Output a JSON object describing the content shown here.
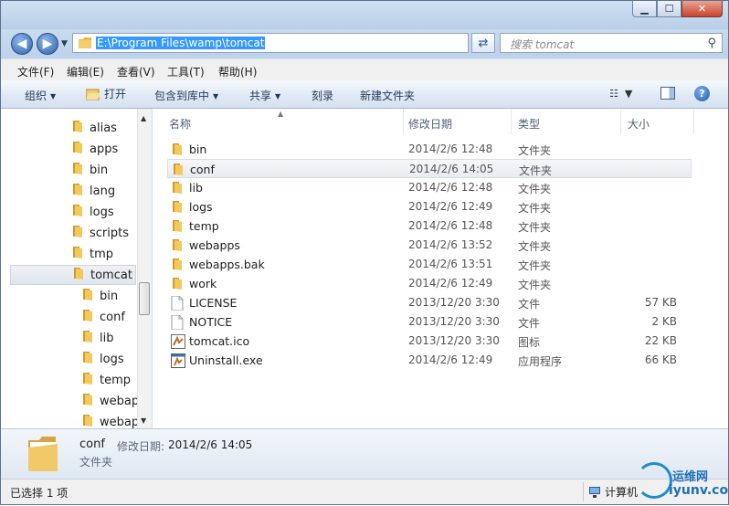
{
  "address": {
    "path": "E:\\Program Files\\wamp\\tomcat"
  },
  "search": {
    "placeholder": "搜索 tomcat"
  },
  "menu": [
    "文件(F)",
    "编辑(E)",
    "查看(V)",
    "工具(T)",
    "帮助(H)"
  ],
  "commands": {
    "organize": "组织",
    "open": "打开",
    "include": "包含到库中",
    "share": "共享",
    "burn": "刻录",
    "new_folder": "新建文件夹"
  },
  "tree": {
    "items": [
      {
        "label": "alias"
      },
      {
        "label": "apps"
      },
      {
        "label": "bin"
      },
      {
        "label": "lang"
      },
      {
        "label": "logs"
      },
      {
        "label": "scripts"
      },
      {
        "label": "tmp"
      },
      {
        "label": "tomcat"
      },
      {
        "label": "bin"
      },
      {
        "label": "conf"
      },
      {
        "label": "lib"
      },
      {
        "label": "logs"
      },
      {
        "label": "temp"
      },
      {
        "label": "webap"
      },
      {
        "label": "webap"
      }
    ]
  },
  "columns": {
    "name": "名称",
    "date": "修改日期",
    "type": "类型",
    "size": "大小"
  },
  "files": [
    {
      "name": "bin",
      "date": "2014/2/6 12:48",
      "type": "文件夹",
      "size": "",
      "icon": "folder-icon"
    },
    {
      "name": "conf",
      "date": "2014/2/6 14:05",
      "type": "文件夹",
      "size": "",
      "icon": "folder-icon"
    },
    {
      "name": "lib",
      "date": "2014/2/6 12:48",
      "type": "文件夹",
      "size": "",
      "icon": "folder-icon"
    },
    {
      "name": "logs",
      "date": "2014/2/6 12:49",
      "type": "文件夹",
      "size": "",
      "icon": "folder-icon"
    },
    {
      "name": "temp",
      "date": "2014/2/6 12:48",
      "type": "文件夹",
      "size": "",
      "icon": "folder-icon"
    },
    {
      "name": "webapps",
      "date": "2014/2/6 13:52",
      "type": "文件夹",
      "size": "",
      "icon": "folder-icon"
    },
    {
      "name": "webapps.bak",
      "date": "2014/2/6 13:51",
      "type": "文件夹",
      "size": "",
      "icon": "folder-icon"
    },
    {
      "name": "work",
      "date": "2014/2/6 12:49",
      "type": "文件夹",
      "size": "",
      "icon": "folder-icon"
    },
    {
      "name": "LICENSE",
      "date": "2013/12/20 3:30",
      "type": "文件",
      "size": "57 KB",
      "icon": "file-icon"
    },
    {
      "name": "NOTICE",
      "date": "2013/12/20 3:30",
      "type": "文件",
      "size": "2 KB",
      "icon": "file-icon"
    },
    {
      "name": "tomcat.ico",
      "date": "2013/12/20 3:30",
      "type": "图标",
      "size": "22 KB",
      "icon": "image-file-icon"
    },
    {
      "name": "Uninstall.exe",
      "date": "2014/2/6 12:49",
      "type": "应用程序",
      "size": "66 KB",
      "icon": "exe-file-icon"
    }
  ],
  "details": {
    "name": "conf",
    "modified_label": "修改日期:",
    "modified_value": "2014/2/6 14:05",
    "type": "文件夹"
  },
  "status": {
    "selected": "已选择 1 项",
    "computer": "计算机"
  },
  "watermark": {
    "cn": "运维网",
    "en": "iyunv.com"
  },
  "colors": {
    "selection": "#3399ff",
    "folder": "#e8b94a",
    "accent": "#1f8bd1"
  }
}
